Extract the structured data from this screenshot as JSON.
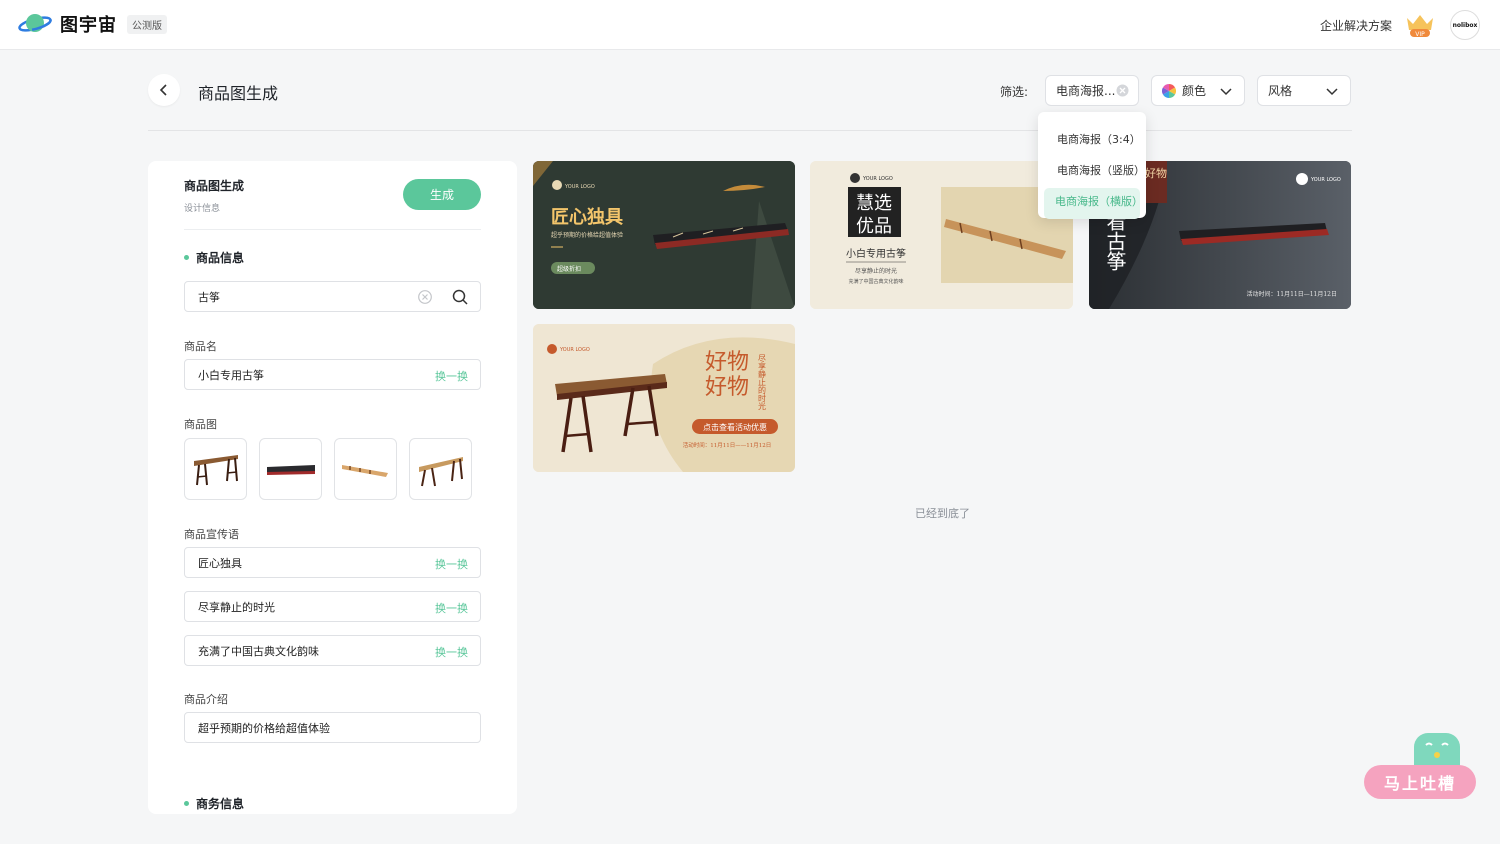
{
  "topbar": {
    "brand_name": "图宇宙",
    "beta_badge": "公测版",
    "enterprise_link": "企业解决方案",
    "vip_badge": "VIP",
    "avatar_text": "nolibox"
  },
  "header": {
    "title": "商品图生成",
    "filter_label": "筛选:",
    "filter_type": "电商海报...",
    "filter_color": "颜色",
    "filter_style": "风格"
  },
  "dropdown": {
    "items": [
      "电商海报（3:4）",
      "电商海报（竖版）",
      "电商海报（横版）"
    ],
    "selected_index": 2
  },
  "panel": {
    "title": "商品图生成",
    "subtitle": "设计信息",
    "generate_label": "生成",
    "section_product": "商品信息",
    "search_value": "古筝",
    "name_label": "商品名",
    "name_value": "小白专用古筝",
    "swap_label": "换一换",
    "image_label": "商品图",
    "slogan_label": "商品宣传语",
    "slogans": [
      "匠心独具",
      "尽享静止的时光",
      "充满了中国古典文化韵味"
    ],
    "intro_label": "商品介绍",
    "intro_value": "超乎预期的价格给超值体验",
    "section_business": "商务信息"
  },
  "cards": {
    "c1": {
      "logo": "YOUR LOGO",
      "title": "匠心独具",
      "sub": "超乎预期的价格给超值体验",
      "tag": "超级折扣"
    },
    "c2": {
      "logo": "YOUR LOGO",
      "badge1": "慧选",
      "badge2": "优品",
      "name": "小白专用古筝",
      "line1": "尽享静止的时光",
      "line2": "充满了中国古典文化韵味"
    },
    "c3": {
      "logo": "YOUR LOGO",
      "vertical_title": "看古筝",
      "corner": "好物",
      "date": "活动时间：11月11日—11月12日"
    },
    "c4": {
      "logo": "YOUR LOGO",
      "title1": "好物",
      "title2": "好物",
      "vertical": "尽享静止的时光",
      "button": "点击查看活动优惠",
      "date": "活动时间：11月11日——11月12日"
    }
  },
  "bottom_text": "已经到底了",
  "feedback_label": "马上吐槽",
  "colors": {
    "accent": "#5bc79b",
    "accent_light": "#e3f5ee",
    "feedback_pink": "#f5a3bf"
  }
}
